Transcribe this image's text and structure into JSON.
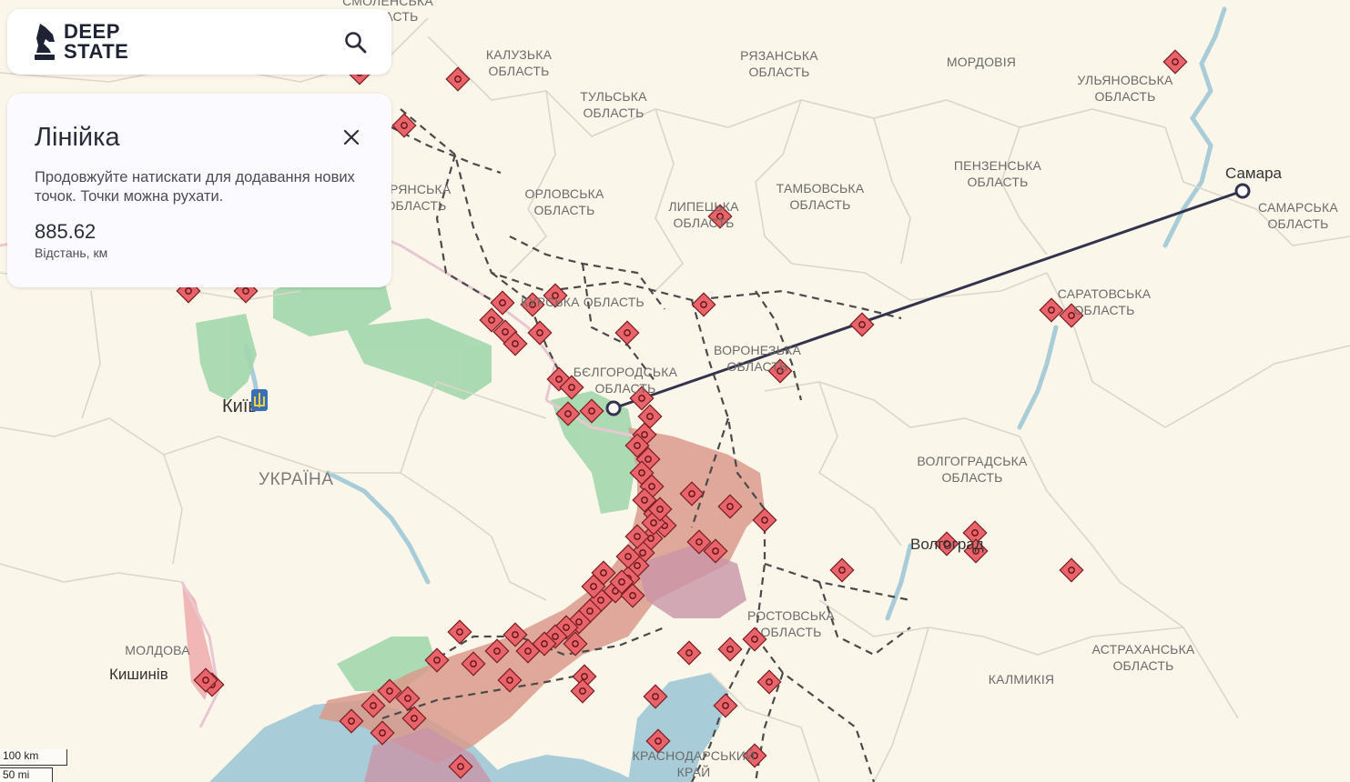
{
  "app": {
    "brand_line1": "DEEP",
    "brand_line2": "STATE"
  },
  "colors": {
    "background": "#fbf6ea",
    "sea": "#a8cdd8",
    "occupied": "#d99a8c",
    "liberated": "#9fd6a8",
    "ruler_line": "#33334d",
    "marker": "#e8636a"
  },
  "ruler": {
    "title": "Лінійка",
    "description": "Продовжуйте натискати для додавання нових точок. Точки можна рухати.",
    "distance": "885.62",
    "unit_label": "Відстань, км"
  },
  "map": {
    "regions": [
      "СМОЛЕНСЬКА ОБЛАСТЬ",
      "КАЛУЗЬКА ОБЛАСТЬ",
      "РЯЗАНСЬКА ОБЛАСТЬ",
      "МОРДОВІЯ",
      "УЛЬЯНОВСЬКА ОБЛАСТЬ",
      "ТУЛЬСЬКА ОБЛАСТЬ",
      "ПЕНЗЕНСЬКА ОБЛАСТЬ",
      "БРЯНСЬКА ОБЛАСТЬ",
      "ОРЛОВСЬКА ОБЛАСТЬ",
      "ЛИПЕЦЬКА ОБЛАСТЬ",
      "ТАМБОВСЬКА ОБЛАСТЬ",
      "САМАРСЬКА ОБЛАСТЬ",
      "КУРСЬКА ОБЛАСТЬ",
      "САРАТОВСЬКА ОБЛАСТЬ",
      "ВОРОНЕЗЬКА ОБЛАСТЬ",
      "БЄЛГОРОДСЬКА ОБЛАСТЬ",
      "ВОЛГОГРАДСЬКА ОБЛАСТЬ",
      "РОСТОВСЬКА ОБЛАСТЬ",
      "АСТРАХАНСЬКА ОБЛАСТЬ",
      "КАЛМИКІЯ",
      "КРАСНОДАРСЬКИЙ КРАЙ",
      "МОЛДОВА"
    ],
    "cities": [
      "Самара",
      "Київ",
      "Кишинів",
      "Волгоград"
    ],
    "country": "УКРАЇНА"
  },
  "scale": {
    "km": "100 km",
    "mi": "50 mi"
  }
}
